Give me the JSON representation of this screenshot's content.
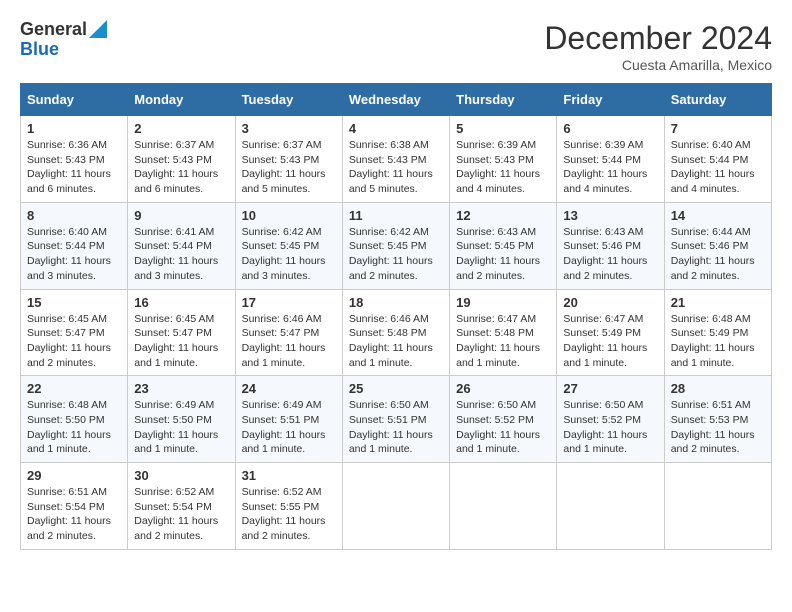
{
  "header": {
    "logo_line1": "General",
    "logo_line2": "Blue",
    "month_title": "December 2024",
    "location": "Cuesta Amarilla, Mexico"
  },
  "weekdays": [
    "Sunday",
    "Monday",
    "Tuesday",
    "Wednesday",
    "Thursday",
    "Friday",
    "Saturday"
  ],
  "weeks": [
    [
      {
        "day": "1",
        "sunrise": "6:36 AM",
        "sunset": "5:43 PM",
        "daylight": "11 hours and 6 minutes."
      },
      {
        "day": "2",
        "sunrise": "6:37 AM",
        "sunset": "5:43 PM",
        "daylight": "11 hours and 6 minutes."
      },
      {
        "day": "3",
        "sunrise": "6:37 AM",
        "sunset": "5:43 PM",
        "daylight": "11 hours and 5 minutes."
      },
      {
        "day": "4",
        "sunrise": "6:38 AM",
        "sunset": "5:43 PM",
        "daylight": "11 hours and 5 minutes."
      },
      {
        "day": "5",
        "sunrise": "6:39 AM",
        "sunset": "5:43 PM",
        "daylight": "11 hours and 4 minutes."
      },
      {
        "day": "6",
        "sunrise": "6:39 AM",
        "sunset": "5:44 PM",
        "daylight": "11 hours and 4 minutes."
      },
      {
        "day": "7",
        "sunrise": "6:40 AM",
        "sunset": "5:44 PM",
        "daylight": "11 hours and 4 minutes."
      }
    ],
    [
      {
        "day": "8",
        "sunrise": "6:40 AM",
        "sunset": "5:44 PM",
        "daylight": "11 hours and 3 minutes."
      },
      {
        "day": "9",
        "sunrise": "6:41 AM",
        "sunset": "5:44 PM",
        "daylight": "11 hours and 3 minutes."
      },
      {
        "day": "10",
        "sunrise": "6:42 AM",
        "sunset": "5:45 PM",
        "daylight": "11 hours and 3 minutes."
      },
      {
        "day": "11",
        "sunrise": "6:42 AM",
        "sunset": "5:45 PM",
        "daylight": "11 hours and 2 minutes."
      },
      {
        "day": "12",
        "sunrise": "6:43 AM",
        "sunset": "5:45 PM",
        "daylight": "11 hours and 2 minutes."
      },
      {
        "day": "13",
        "sunrise": "6:43 AM",
        "sunset": "5:46 PM",
        "daylight": "11 hours and 2 minutes."
      },
      {
        "day": "14",
        "sunrise": "6:44 AM",
        "sunset": "5:46 PM",
        "daylight": "11 hours and 2 minutes."
      }
    ],
    [
      {
        "day": "15",
        "sunrise": "6:45 AM",
        "sunset": "5:47 PM",
        "daylight": "11 hours and 2 minutes."
      },
      {
        "day": "16",
        "sunrise": "6:45 AM",
        "sunset": "5:47 PM",
        "daylight": "11 hours and 1 minute."
      },
      {
        "day": "17",
        "sunrise": "6:46 AM",
        "sunset": "5:47 PM",
        "daylight": "11 hours and 1 minute."
      },
      {
        "day": "18",
        "sunrise": "6:46 AM",
        "sunset": "5:48 PM",
        "daylight": "11 hours and 1 minute."
      },
      {
        "day": "19",
        "sunrise": "6:47 AM",
        "sunset": "5:48 PM",
        "daylight": "11 hours and 1 minute."
      },
      {
        "day": "20",
        "sunrise": "6:47 AM",
        "sunset": "5:49 PM",
        "daylight": "11 hours and 1 minute."
      },
      {
        "day": "21",
        "sunrise": "6:48 AM",
        "sunset": "5:49 PM",
        "daylight": "11 hours and 1 minute."
      }
    ],
    [
      {
        "day": "22",
        "sunrise": "6:48 AM",
        "sunset": "5:50 PM",
        "daylight": "11 hours and 1 minute."
      },
      {
        "day": "23",
        "sunrise": "6:49 AM",
        "sunset": "5:50 PM",
        "daylight": "11 hours and 1 minute."
      },
      {
        "day": "24",
        "sunrise": "6:49 AM",
        "sunset": "5:51 PM",
        "daylight": "11 hours and 1 minute."
      },
      {
        "day": "25",
        "sunrise": "6:50 AM",
        "sunset": "5:51 PM",
        "daylight": "11 hours and 1 minute."
      },
      {
        "day": "26",
        "sunrise": "6:50 AM",
        "sunset": "5:52 PM",
        "daylight": "11 hours and 1 minute."
      },
      {
        "day": "27",
        "sunrise": "6:50 AM",
        "sunset": "5:52 PM",
        "daylight": "11 hours and 1 minute."
      },
      {
        "day": "28",
        "sunrise": "6:51 AM",
        "sunset": "5:53 PM",
        "daylight": "11 hours and 2 minutes."
      }
    ],
    [
      {
        "day": "29",
        "sunrise": "6:51 AM",
        "sunset": "5:54 PM",
        "daylight": "11 hours and 2 minutes."
      },
      {
        "day": "30",
        "sunrise": "6:52 AM",
        "sunset": "5:54 PM",
        "daylight": "11 hours and 2 minutes."
      },
      {
        "day": "31",
        "sunrise": "6:52 AM",
        "sunset": "5:55 PM",
        "daylight": "11 hours and 2 minutes."
      },
      null,
      null,
      null,
      null
    ]
  ]
}
